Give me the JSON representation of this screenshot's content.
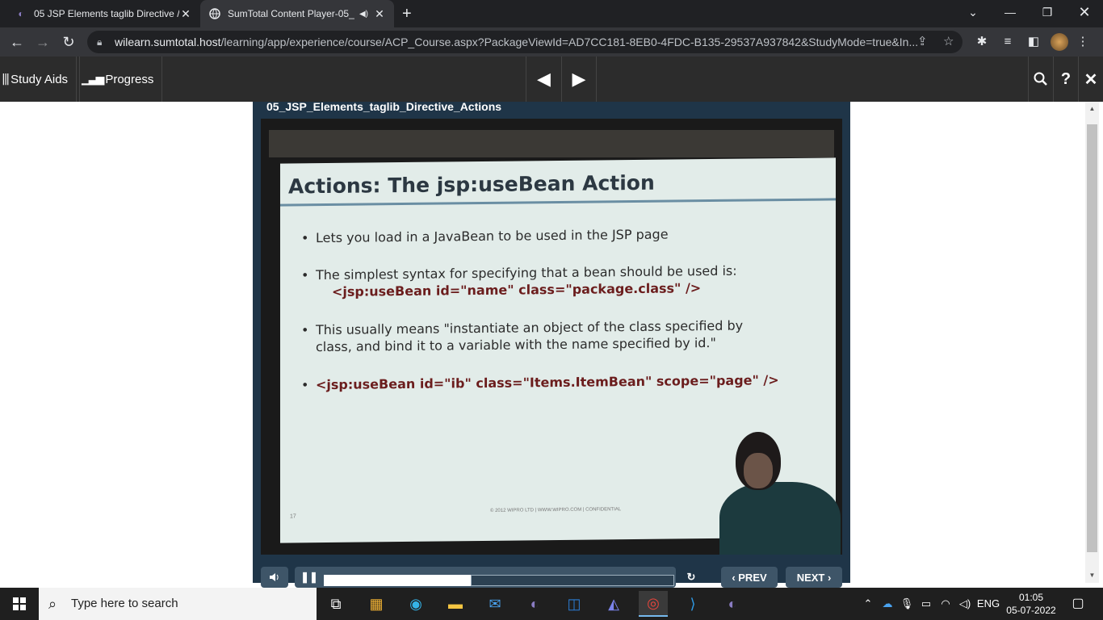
{
  "browser": {
    "tabs": [
      {
        "title": "05 JSP Elements taglib Directive /",
        "favicon": "eclipse-icon",
        "active": false
      },
      {
        "title": "SumTotal Content Player-05_",
        "favicon": "globe-icon",
        "active": true
      }
    ],
    "url_host": "wilearn.sumtotal.host",
    "url_path": "/learning/app/experience/course/ACP_Course.aspx?PackageViewId=AD7CC181-8EB0-4FDC-B135-29537A937842&StudyMode=true&In..."
  },
  "appbar": {
    "study_aids_label": "Study Aids",
    "progress_label": "Progress"
  },
  "player": {
    "title": "05_JSP_Elements_taglib_Directive_Actions",
    "slide": {
      "heading": "Actions: The jsp:useBean Action",
      "bullet1": "Lets you load in a JavaBean to be used in the JSP page",
      "bullet2_line1": "The simplest syntax for specifying that a bean should be used is:",
      "bullet2_code": "<jsp:useBean id=\"name\" class=\"package.class\" />",
      "bullet3_line1": "This usually means \"instantiate an object of the class specified by",
      "bullet3_line2": "class, and bind it to a variable with the name specified by id.\"",
      "bullet4_code": "<jsp:useBean id=\"ib\" class=\"Items.ItemBean\" scope=\"page\" />",
      "footer": "© 2012 WIPRO LTD | WWW.WIPRO.COM | CONFIDENTIAL",
      "page_number": "17"
    },
    "prev_label": "PREV",
    "next_label": "NEXT",
    "progress": 0.42
  },
  "taskbar": {
    "search_placeholder": "Type here to search",
    "language": "ENG",
    "time": "01:05",
    "date": "05-07-2022"
  }
}
